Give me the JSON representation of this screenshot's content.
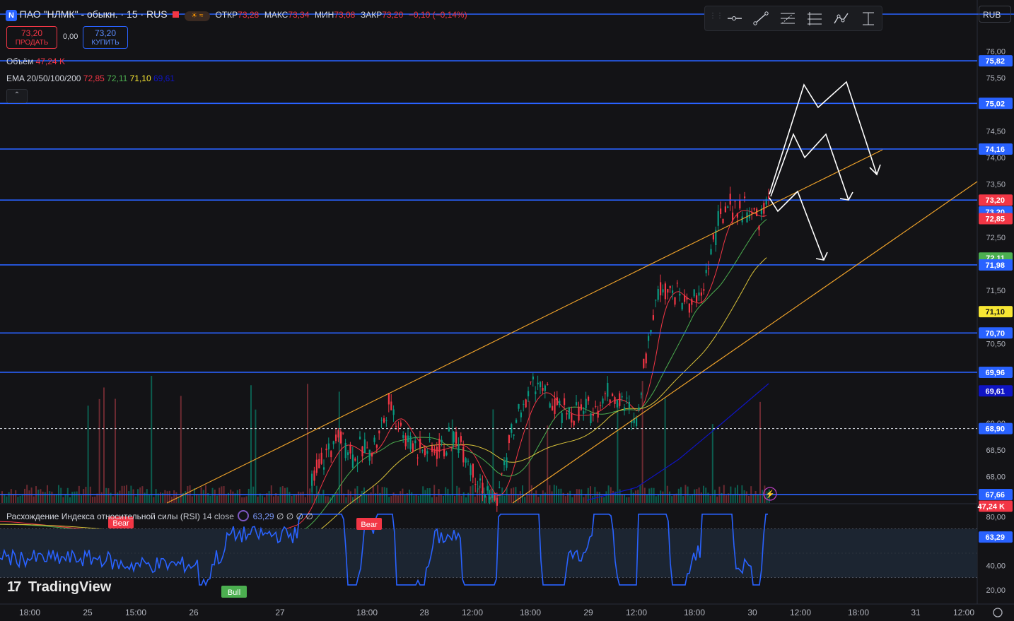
{
  "header": {
    "symbol_badge": "N",
    "title": "ПАО \"НЛМК\" - обыкн. · 15 · RUS",
    "open_label": "ОТКР",
    "open_value": "73,28",
    "high_label": "МАКС",
    "high_value": "73,34",
    "low_label": "МИН",
    "low_value": "73,08",
    "close_label": "ЗАКР",
    "close_value": "73,20",
    "change": "−0,10 (−0,14%)"
  },
  "trade": {
    "sell_price": "73,20",
    "sell_label": "ПРОДАТЬ",
    "spread": "0,00",
    "buy_price": "73,20",
    "buy_label": "КУПИТЬ"
  },
  "indicators": {
    "volume_label": "Объём",
    "volume_value": "47,24 K",
    "ema_label": "EMA 20/50/100/200",
    "ema20": "72,85",
    "ema50": "72,11",
    "ema100": "71,10",
    "ema200": "69,61"
  },
  "rsi_header": {
    "label": "Расхождение Индекса относительной силы (RSI)",
    "params": "14 close",
    "value": "63,29",
    "extras": "∅ ∅ ∅ ∅"
  },
  "currency": "RUB",
  "brand": "TradingView",
  "toolbar_icons": [
    "horizontal-ray-icon",
    "trend-line-icon",
    "fib-retracement-icon",
    "long-position-icon",
    "path-icon",
    "date-range-icon"
  ],
  "chart_data": {
    "type": "candlestick",
    "y_range": [
      67.5,
      76.3
    ],
    "y_ticks": [
      "76,00",
      "75,50",
      "74,50",
      "74,00",
      "73,50",
      "73,00",
      "72,50",
      "71,50",
      "70,50",
      "69,00",
      "68,50",
      "68,00"
    ],
    "x_ticks": [
      "18:00",
      "25",
      "15:00",
      "26",
      "27",
      "18:00",
      "28",
      "12:00",
      "18:00",
      "29",
      "12:00",
      "18:00",
      "30",
      "12:00",
      "18:00",
      "31",
      "12:00"
    ],
    "horizontal_levels": [
      75.82,
      75.02,
      74.16,
      73.2,
      71.98,
      70.7,
      69.96,
      67.66
    ],
    "dashed_level": 68.9,
    "price_labels": [
      {
        "text": "75,82",
        "value": 75.82,
        "color": "#2962ff"
      },
      {
        "text": "75,02",
        "value": 75.02,
        "color": "#2962ff"
      },
      {
        "text": "74,16",
        "value": 74.16,
        "color": "#2962ff"
      },
      {
        "text": "73,20",
        "value": 73.2,
        "color": "#2962ff",
        "offset": -0.22
      },
      {
        "text": "73,20",
        "value": 73.2,
        "color": "#f23645"
      },
      {
        "text": "72,85",
        "value": 72.85,
        "color": "#f23645"
      },
      {
        "text": "72,11",
        "value": 72.11,
        "color": "#4caf50"
      },
      {
        "text": "71,98",
        "value": 71.98,
        "color": "#2962ff"
      },
      {
        "text": "71,10",
        "value": 71.1,
        "color": "#f7e633"
      },
      {
        "text": "70,70",
        "value": 70.7,
        "color": "#2962ff"
      },
      {
        "text": "69,96",
        "value": 69.96,
        "color": "#2962ff"
      },
      {
        "text": "69,61",
        "value": 69.61,
        "color": "#0f14c4"
      },
      {
        "text": "68,90",
        "value": 68.9,
        "color": "#2962ff"
      },
      {
        "text": "67,66",
        "value": 67.66,
        "color": "#2962ff"
      },
      {
        "text": "47,24 K",
        "value": 67.44,
        "color": "#f23645"
      }
    ],
    "rsi": {
      "range": [
        10,
        90
      ],
      "ticks": [
        "80,00",
        "40,00",
        "20,00"
      ],
      "band": [
        70,
        30
      ],
      "value_label": "63,29",
      "value": 63.29,
      "markers": [
        {
          "text": "Bear",
          "color": "#f23645"
        },
        {
          "text": "Bear",
          "color": "#f23645"
        },
        {
          "text": "Bull",
          "color": "#4caf50"
        }
      ]
    }
  }
}
